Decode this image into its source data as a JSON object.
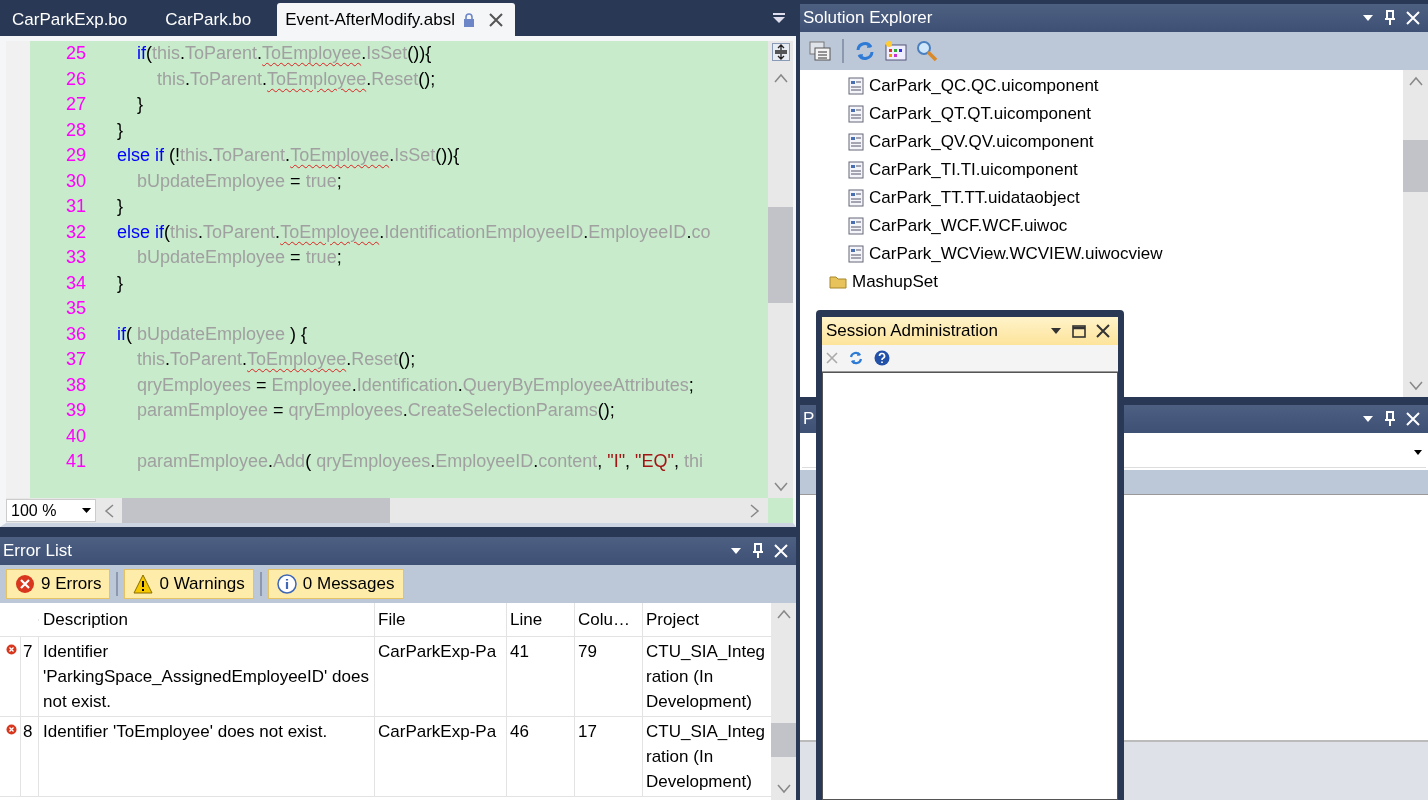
{
  "editor": {
    "tabs": [
      {
        "label": "CarParkExp.bo",
        "selected": false
      },
      {
        "label": "CarPark.bo",
        "selected": false
      },
      {
        "label": "Event-AfterModify.absl",
        "selected": true
      }
    ],
    "lines": [
      {
        "number": "25",
        "tokens": [
          {
            "kind": "kw",
            "text": "    if"
          },
          {
            "kind": "pun",
            "text": "("
          },
          {
            "kind": "id",
            "text": "this"
          },
          {
            "kind": "pun",
            "text": "."
          },
          {
            "kind": "id",
            "text": "ToParent"
          },
          {
            "kind": "pun",
            "text": "."
          },
          {
            "kind": "err",
            "text": "ToEmployee"
          },
          {
            "kind": "pun",
            "text": "."
          },
          {
            "kind": "id",
            "text": "IsSet"
          },
          {
            "kind": "pun",
            "text": "()){"
          }
        ]
      },
      {
        "number": "26",
        "tokens": [
          {
            "kind": "id",
            "text": "        this"
          },
          {
            "kind": "pun",
            "text": "."
          },
          {
            "kind": "id",
            "text": "ToParent"
          },
          {
            "kind": "pun",
            "text": "."
          },
          {
            "kind": "err",
            "text": "ToEmployee"
          },
          {
            "kind": "pun",
            "text": "."
          },
          {
            "kind": "id",
            "text": "Reset"
          },
          {
            "kind": "pun",
            "text": "();"
          }
        ]
      },
      {
        "number": "27",
        "tokens": [
          {
            "kind": "pun",
            "text": "    }"
          }
        ]
      },
      {
        "number": "28",
        "tokens": [
          {
            "kind": "pun",
            "text": "}"
          }
        ]
      },
      {
        "number": "29",
        "tokens": [
          {
            "kind": "kw",
            "text": "else if"
          },
          {
            "kind": "pun",
            "text": " (!"
          },
          {
            "kind": "id",
            "text": "this"
          },
          {
            "kind": "pun",
            "text": "."
          },
          {
            "kind": "id",
            "text": "ToParent"
          },
          {
            "kind": "pun",
            "text": "."
          },
          {
            "kind": "err",
            "text": "ToEmployee"
          },
          {
            "kind": "pun",
            "text": "."
          },
          {
            "kind": "id",
            "text": "IsSet"
          },
          {
            "kind": "pun",
            "text": "()){"
          }
        ]
      },
      {
        "number": "30",
        "tokens": [
          {
            "kind": "id",
            "text": "    bUpdateEmployee"
          },
          {
            "kind": "pun",
            "text": " = "
          },
          {
            "kind": "id",
            "text": "true"
          },
          {
            "kind": "pun",
            "text": ";"
          }
        ]
      },
      {
        "number": "31",
        "tokens": [
          {
            "kind": "pun",
            "text": "}"
          }
        ]
      },
      {
        "number": "32",
        "tokens": [
          {
            "kind": "kw",
            "text": "else if"
          },
          {
            "kind": "pun",
            "text": "("
          },
          {
            "kind": "id",
            "text": "this"
          },
          {
            "kind": "pun",
            "text": "."
          },
          {
            "kind": "id",
            "text": "ToParent"
          },
          {
            "kind": "pun",
            "text": "."
          },
          {
            "kind": "err",
            "text": "ToEmployee"
          },
          {
            "kind": "pun",
            "text": "."
          },
          {
            "kind": "id",
            "text": "IdentificationEmployeeID"
          },
          {
            "kind": "pun",
            "text": "."
          },
          {
            "kind": "id",
            "text": "EmployeeID"
          },
          {
            "kind": "pun",
            "text": "."
          },
          {
            "kind": "id",
            "text": "co"
          }
        ]
      },
      {
        "number": "33",
        "tokens": [
          {
            "kind": "id",
            "text": "    bUpdateEmployee"
          },
          {
            "kind": "pun",
            "text": " = "
          },
          {
            "kind": "id",
            "text": "true"
          },
          {
            "kind": "pun",
            "text": ";"
          }
        ]
      },
      {
        "number": "34",
        "tokens": [
          {
            "kind": "pun",
            "text": "}"
          }
        ]
      },
      {
        "number": "35"
      },
      {
        "number": "36",
        "tokens": [
          {
            "kind": "kw",
            "text": "if"
          },
          {
            "kind": "pun",
            "text": "( "
          },
          {
            "kind": "id",
            "text": "bUpdateEmployee"
          },
          {
            "kind": "pun",
            "text": " ) {"
          }
        ]
      },
      {
        "number": "37",
        "tokens": [
          {
            "kind": "id",
            "text": "    this"
          },
          {
            "kind": "pun",
            "text": "."
          },
          {
            "kind": "id",
            "text": "ToParent"
          },
          {
            "kind": "pun",
            "text": "."
          },
          {
            "kind": "err",
            "text": "ToEmployee"
          },
          {
            "kind": "pun",
            "text": "."
          },
          {
            "kind": "id",
            "text": "Reset"
          },
          {
            "kind": "pun",
            "text": "();"
          }
        ]
      },
      {
        "number": "38",
        "tokens": [
          {
            "kind": "id",
            "text": "    qryEmployees"
          },
          {
            "kind": "pun",
            "text": " = "
          },
          {
            "kind": "id",
            "text": "Employee"
          },
          {
            "kind": "pun",
            "text": "."
          },
          {
            "kind": "id",
            "text": "Identification"
          },
          {
            "kind": "pun",
            "text": "."
          },
          {
            "kind": "id",
            "text": "QueryByEmployeeAttributes"
          },
          {
            "kind": "pun",
            "text": ";"
          }
        ]
      },
      {
        "number": "39",
        "tokens": [
          {
            "kind": "id",
            "text": "    paramEmployee"
          },
          {
            "kind": "pun",
            "text": " = "
          },
          {
            "kind": "id",
            "text": "qryEmployees"
          },
          {
            "kind": "pun",
            "text": "."
          },
          {
            "kind": "id",
            "text": "CreateSelectionParams"
          },
          {
            "kind": "pun",
            "text": "();"
          }
        ]
      },
      {
        "number": "40"
      },
      {
        "number": "41",
        "tokens": [
          {
            "kind": "id",
            "text": "    paramEmployee"
          },
          {
            "kind": "pun",
            "text": "."
          },
          {
            "kind": "id",
            "text": "Add"
          },
          {
            "kind": "pun",
            "text": "( "
          },
          {
            "kind": "id",
            "text": "qryEmployees"
          },
          {
            "kind": "pun",
            "text": "."
          },
          {
            "kind": "id",
            "text": "EmployeeID"
          },
          {
            "kind": "pun",
            "text": "."
          },
          {
            "kind": "id",
            "text": "content"
          },
          {
            "kind": "pun",
            "text": ", "
          },
          {
            "kind": "str",
            "text": "\"I\""
          },
          {
            "kind": "pun",
            "text": ", "
          },
          {
            "kind": "str",
            "text": "\"EQ\""
          },
          {
            "kind": "pun",
            "text": ", "
          },
          {
            "kind": "id",
            "text": "thi"
          }
        ]
      }
    ],
    "zoom": "100 %"
  },
  "error_list": {
    "title": "Error List",
    "filters": [
      {
        "kind": "error",
        "label": "9 Errors",
        "selected": true
      },
      {
        "kind": "warning",
        "label": "0 Warnings",
        "selected": true
      },
      {
        "kind": "message",
        "label": "0 Messages",
        "selected": true
      }
    ],
    "columns": [
      "Description",
      "File",
      "Line",
      "Colu…",
      "Project"
    ],
    "rows": [
      {
        "kind": "error",
        "number": "7",
        "description": "Identifier 'ParkingSpace_AssignedEmployeeID' does not exist.",
        "file": "CarParkExp-Pa",
        "line": "41",
        "column": "79",
        "project": "CTU_SIA_Integration (In Development)"
      },
      {
        "kind": "error",
        "number": "8",
        "description": "Identifier 'ToEmployee' does not exist.",
        "file": "CarParkExp-Pa",
        "line": "46",
        "column": "17",
        "project": "CTU_SIA_Integration (In Development)"
      }
    ]
  },
  "solution_explorer": {
    "title": "Solution Explorer",
    "items": [
      {
        "kind": "file",
        "label": "CarPark_QC.QC.uicomponent"
      },
      {
        "kind": "file",
        "label": "CarPark_QT.QT.uicomponent"
      },
      {
        "kind": "file",
        "label": "CarPark_QV.QV.uicomponent"
      },
      {
        "kind": "file",
        "label": "CarPark_TI.TI.uicomponent"
      },
      {
        "kind": "file",
        "label": "CarPark_TT.TT.uidataobject"
      },
      {
        "kind": "file",
        "label": "CarPark_WCF.WCF.uiwoc"
      },
      {
        "kind": "file",
        "label": "CarPark_WCView.WCVIEW.uiwocview"
      },
      {
        "kind": "folder",
        "label": "MashupSet"
      }
    ]
  },
  "properties": {
    "title": "P"
  },
  "session_administration": {
    "title": "Session Administration"
  }
}
